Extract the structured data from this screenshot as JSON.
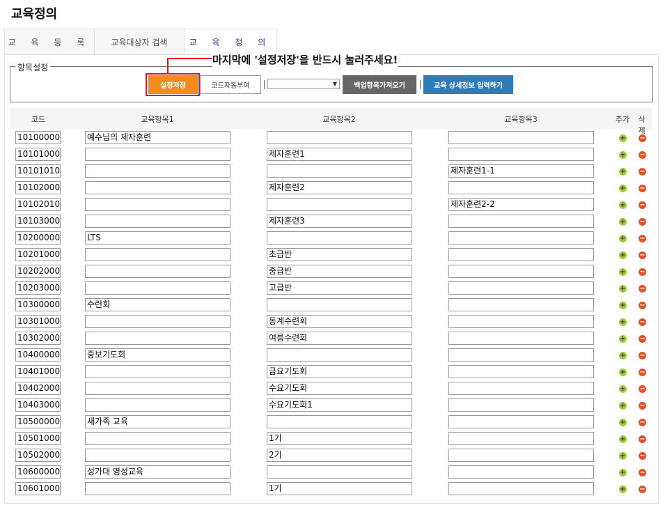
{
  "page_title": "교육정의",
  "tabs": [
    {
      "label": "교 육 등 록"
    },
    {
      "label": "교육대상자 검색"
    },
    {
      "label": "교 육 정 의"
    }
  ],
  "notice": "마지막에 '설정저장'을 반드시 눌러주세요!",
  "settings": {
    "legend": "항목설정",
    "save_label": "설정저장",
    "auto_code_label": "코드자동부여",
    "select_value": "",
    "backup_label": "백업항목가져오기",
    "detail_label": "교육 상세정보 입력하기"
  },
  "table": {
    "headers": {
      "code": "코드",
      "item1": "교육항목1",
      "item2": "교육항목2",
      "item3": "교육항목3",
      "add": "추가",
      "delete": "삭제"
    },
    "rows": [
      [
        "10100000",
        "예수님의 제자훈련",
        "",
        ""
      ],
      [
        "10101000",
        "",
        "제자훈련1",
        ""
      ],
      [
        "10101010",
        "",
        "",
        "제자훈련1-1"
      ],
      [
        "10102000",
        "",
        "제자훈련2",
        ""
      ],
      [
        "10102010",
        "",
        "",
        "제자훈련2-2"
      ],
      [
        "10103000",
        "",
        "제자훈련3",
        ""
      ],
      [
        "10200000",
        "LTS",
        "",
        ""
      ],
      [
        "10201000",
        "",
        "초급반",
        ""
      ],
      [
        "10202000",
        "",
        "중급반",
        ""
      ],
      [
        "10203000",
        "",
        "고급반",
        ""
      ],
      [
        "10300000",
        "수련회",
        "",
        ""
      ],
      [
        "10301000",
        "",
        "동계수련회",
        ""
      ],
      [
        "10302000",
        "",
        "여름수련회",
        ""
      ],
      [
        "10400000",
        "중보기도회",
        "",
        ""
      ],
      [
        "10401000",
        "",
        "금요기도회",
        ""
      ],
      [
        "10402000",
        "",
        "수요기도회",
        ""
      ],
      [
        "10403000",
        "",
        "수요기도회1",
        ""
      ],
      [
        "10500000",
        "새가족 교육",
        "",
        ""
      ],
      [
        "10501000",
        "",
        "1기",
        ""
      ],
      [
        "10502000",
        "",
        "2기",
        ""
      ],
      [
        "10600000",
        "성가대 영성교육",
        "",
        ""
      ],
      [
        "10601000",
        "",
        "1기",
        ""
      ]
    ]
  },
  "colors": {
    "accent_orange": "#f28c1c",
    "accent_blue": "#2f7ab8",
    "highlight_red": "#e8121b"
  }
}
